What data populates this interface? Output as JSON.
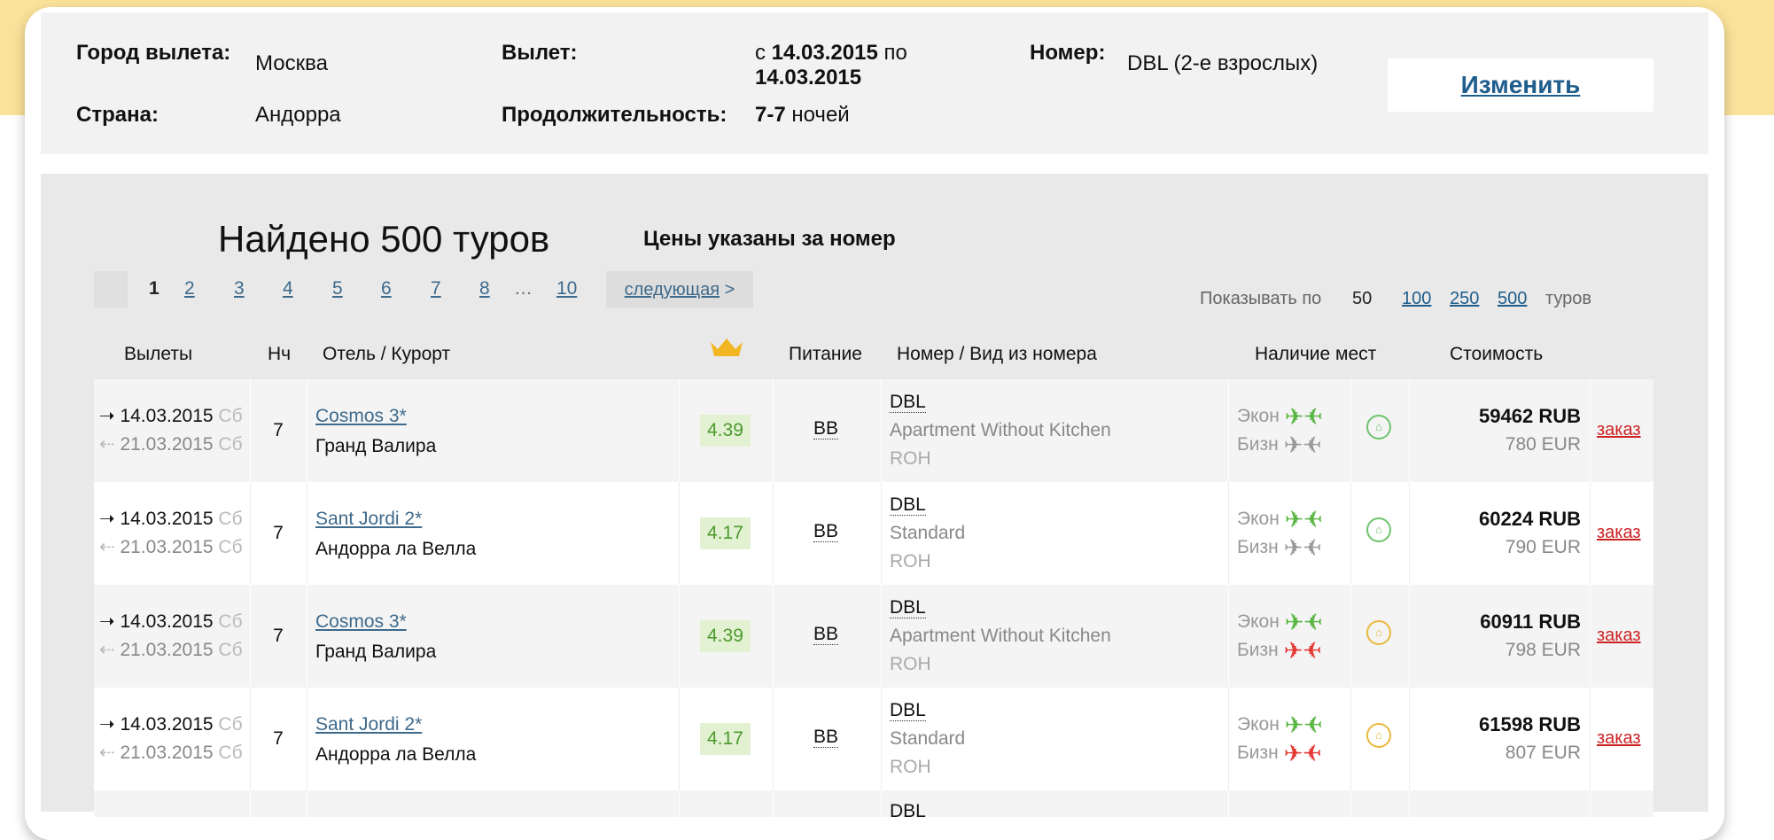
{
  "search": {
    "city_label": "Город вылета:",
    "city_value": "Москва",
    "country_label": "Страна:",
    "country_value": "Андорра",
    "departure_label": "Вылет:",
    "departure_from": "с",
    "departure_date_from": "14.03.2015",
    "departure_to": "по",
    "departure_date_to": "14.03.2015",
    "duration_label": "Продолжительность:",
    "duration_value": "7-7",
    "duration_unit": "ночей",
    "room_label": "Номер:",
    "room_value": "DBL (2-е взрослых)",
    "change_label": "Изменить"
  },
  "results": {
    "found": "Найдено 500 туров",
    "prices_note": "Цены указаны за номер",
    "pages": [
      "1",
      "2",
      "3",
      "4",
      "5",
      "6",
      "7",
      "8",
      "…",
      "10"
    ],
    "next_label": "следующая",
    "next_arrow": ">",
    "show_by_label": "Показывать по",
    "show_by_current": "50",
    "show_by_options": [
      "100",
      "250",
      "500"
    ],
    "show_by_suffix": "туров"
  },
  "table": {
    "headers": {
      "departures": "Вылеты",
      "nights": "Нч",
      "hotel": "Отель / Курорт",
      "crown": "crown-icon",
      "meal": "Питание",
      "room": "Номер / Вид из номера",
      "availability": "Наличие мест",
      "price": "Стоимость"
    },
    "rows": [
      {
        "date_out": "14.03.2015",
        "day_out": "Сб",
        "date_back": "21.03.2015",
        "day_back": "Сб",
        "nights": "7",
        "hotel": "Cosmos 3*",
        "resort": "Гранд Валира",
        "rating": "4.39",
        "meal": "BB",
        "room_type": "DBL",
        "room_desc": "Apartment Without Kitchen",
        "room_view": "ROH",
        "econ": "Экон",
        "biz": "Бизн",
        "econ_status": "green",
        "biz_status": "gray",
        "hotel_status": "green",
        "price_rub": "59462 RUB",
        "price_eur": "780 EUR",
        "order": "заказ"
      },
      {
        "date_out": "14.03.2015",
        "day_out": "Сб",
        "date_back": "21.03.2015",
        "day_back": "Сб",
        "nights": "7",
        "hotel": "Sant Jordi 2*",
        "resort": "Андорра ла Велла",
        "rating": "4.17",
        "meal": "BB",
        "room_type": "DBL",
        "room_desc": "Standard",
        "room_view": "ROH",
        "econ": "Экон",
        "biz": "Бизн",
        "econ_status": "green",
        "biz_status": "gray",
        "hotel_status": "green",
        "price_rub": "60224 RUB",
        "price_eur": "790 EUR",
        "order": "заказ"
      },
      {
        "date_out": "14.03.2015",
        "day_out": "Сб",
        "date_back": "21.03.2015",
        "day_back": "Сб",
        "nights": "7",
        "hotel": "Cosmos 3*",
        "resort": "Гранд Валира",
        "rating": "4.39",
        "meal": "BB",
        "room_type": "DBL",
        "room_desc": "Apartment Without Kitchen",
        "room_view": "ROH",
        "econ": "Экон",
        "biz": "Бизн",
        "econ_status": "green",
        "biz_status": "red",
        "hotel_status": "yellow",
        "price_rub": "60911 RUB",
        "price_eur": "798 EUR",
        "order": "заказ"
      },
      {
        "date_out": "14.03.2015",
        "day_out": "Сб",
        "date_back": "21.03.2015",
        "day_back": "Сб",
        "nights": "7",
        "hotel": "Sant Jordi 2*",
        "resort": "Андорра ла Велла",
        "rating": "4.17",
        "meal": "BB",
        "room_type": "DBL",
        "room_desc": "Standard",
        "room_view": "ROH",
        "econ": "Экон",
        "biz": "Бизн",
        "econ_status": "green",
        "biz_status": "red",
        "hotel_status": "yellow",
        "price_rub": "61598 RUB",
        "price_eur": "807 EUR",
        "order": "заказ"
      }
    ],
    "partial_room_type": "DBL"
  }
}
